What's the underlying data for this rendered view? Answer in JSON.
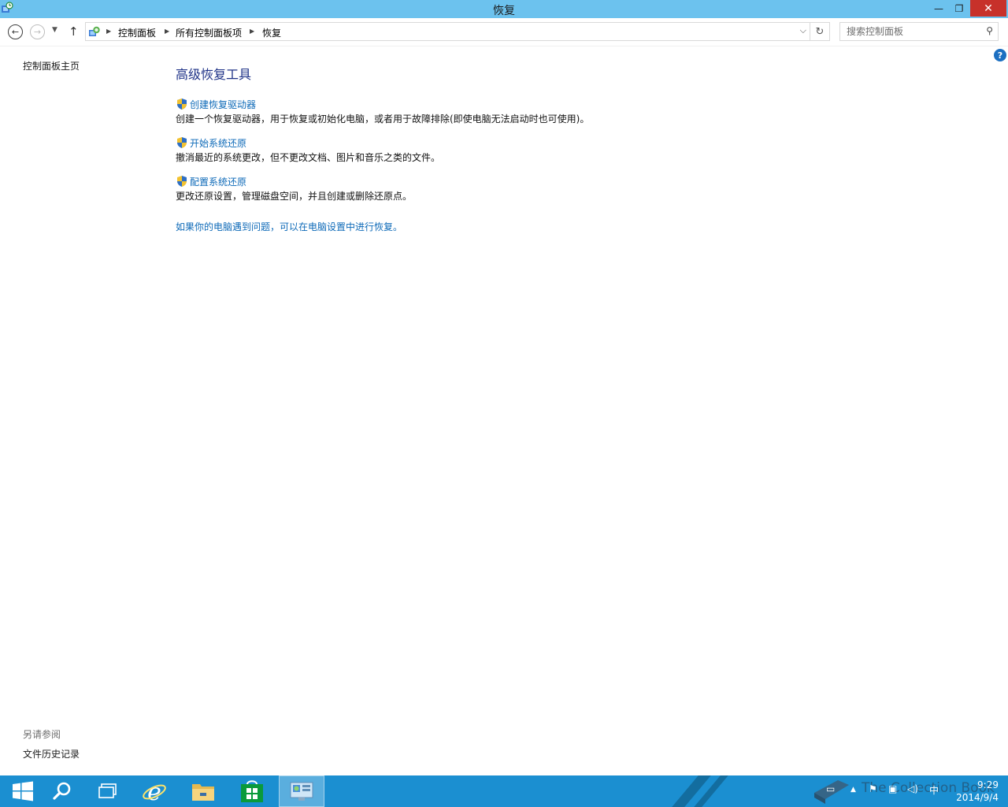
{
  "window": {
    "title": "恢复",
    "minimize_glyph": "—",
    "restore_glyph": "❐",
    "close_glyph": "✕"
  },
  "address_bar": {
    "breadcrumbs": [
      "控制面板",
      "所有控制面板项",
      "恢复"
    ],
    "search_placeholder": "搜索控制面板"
  },
  "left_pane": {
    "home_link": "控制面板主页",
    "see_also_label": "另请参阅",
    "see_also_items": [
      "文件历史记录"
    ]
  },
  "content": {
    "heading": "高级恢复工具",
    "tools": [
      {
        "label": "创建恢复驱动器",
        "description": "创建一个恢复驱动器，用于恢复或初始化电脑，或者用于故障排除(即使电脑无法启动时也可使用)。"
      },
      {
        "label": "开始系统还原",
        "description": "撤消最近的系统更改，但不更改文档、图片和音乐之类的文件。"
      },
      {
        "label": "配置系统还原",
        "description": "更改还原设置，管理磁盘空间，并且创建或删除还原点。"
      }
    ],
    "bottom_link": "如果你的电脑遇到问题，可以在电脑设置中进行恢复。"
  },
  "help": {
    "glyph": "?"
  },
  "taskbar": {
    "items": [
      "start-icon",
      "search-icon",
      "task-view-icon",
      "internet-explorer-icon",
      "file-explorer-icon",
      "store-icon",
      "control-panel-icon"
    ],
    "ime": "中",
    "clock": {
      "time": "9:29",
      "date": "2014/9/4"
    },
    "watermark": "The Collection Book"
  },
  "colors": {
    "titlebar": "#6cc2ee",
    "link": "#0e6ab8",
    "heading": "#1e3287",
    "taskbar": "#1b8fd1",
    "close": "#c7312a"
  }
}
